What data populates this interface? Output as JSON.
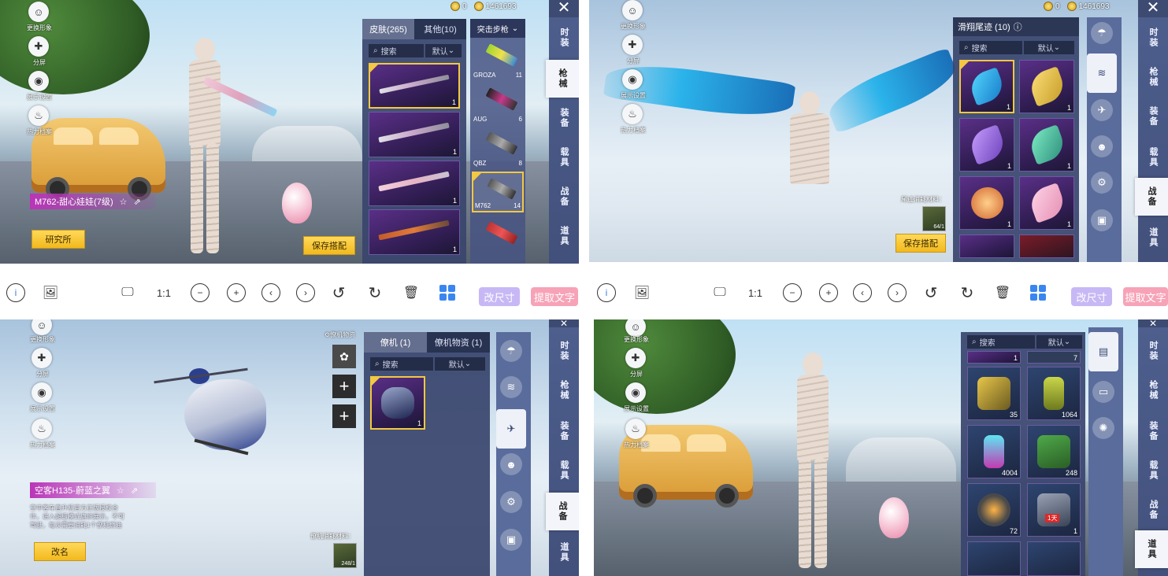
{
  "colors": {
    "accent_yellow": "#f4c842",
    "sidebar_blue": "#4e5f8e",
    "rarity_purple": "#5a2f87",
    "toolbar_resize": "#c7b8f5",
    "toolbar_ocr": "#f7a3b7"
  },
  "currency": {
    "coin": "0",
    "gold": "1461693"
  },
  "left_menu": {
    "appearance": "更换形象",
    "share": "分屏",
    "display": "展示设置",
    "hot": "热力档案"
  },
  "side_tabs": [
    "时装",
    "枪械",
    "装备",
    "载具",
    "战备",
    "道具"
  ],
  "panel1": {
    "tab_skins": "皮肤(265)",
    "tab_other": "其他(10)",
    "weapon_dropdown": "突击步枪",
    "search": "搜索",
    "sort": "默认",
    "slot_counts": [
      "1",
      "1",
      "1",
      "1"
    ],
    "guns": [
      {
        "name": "GROZA",
        "count": "11"
      },
      {
        "name": "AUG",
        "count": "6"
      },
      {
        "name": "QBZ",
        "count": "8"
      },
      {
        "name": "M762",
        "count": "14"
      },
      {
        "name": "",
        "count": ""
      }
    ],
    "item_name": "M762-甜心娃娃(7级)",
    "lab_button": "研究所",
    "save_button": "保存搭配"
  },
  "panel2": {
    "header": "滑翔尾迹 (10)",
    "search": "搜索",
    "sort": "默认",
    "slot_counts": [
      "1",
      "1",
      "1",
      "1",
      "1",
      "1"
    ],
    "material_label": "尾迹消耗材料：",
    "material_count": "64/1",
    "save_button": "保存搭配"
  },
  "panel3": {
    "tab_plane": "僚机 (1)",
    "tab_supply": "僚机物资 (1)",
    "search": "搜索",
    "sort": "默认",
    "corner_label": "僚机物资",
    "slot_count": "1",
    "item_name": "空客H135-蔚蓝之翼",
    "description": "空中客车直升机官方正版授权合作，进入超级模式旗帜展示，不可驾驶，每次需要消耗1个僚机燃油",
    "material_label": "僚机消耗材料：",
    "material_count": "248/1",
    "rename_button": "改名"
  },
  "panel4": {
    "search": "搜索",
    "sort": "默认",
    "top_counts": [
      "1",
      "7"
    ],
    "items": [
      {
        "count": "35"
      },
      {
        "count": "1064"
      },
      {
        "count": "4004"
      },
      {
        "count": "248"
      },
      {
        "count": "72"
      },
      {
        "count": "1",
        "badge": "1天"
      }
    ]
  },
  "toolbar": {
    "resize": "改尺寸",
    "ocr": "提取文字",
    "ratio": "1:1"
  }
}
